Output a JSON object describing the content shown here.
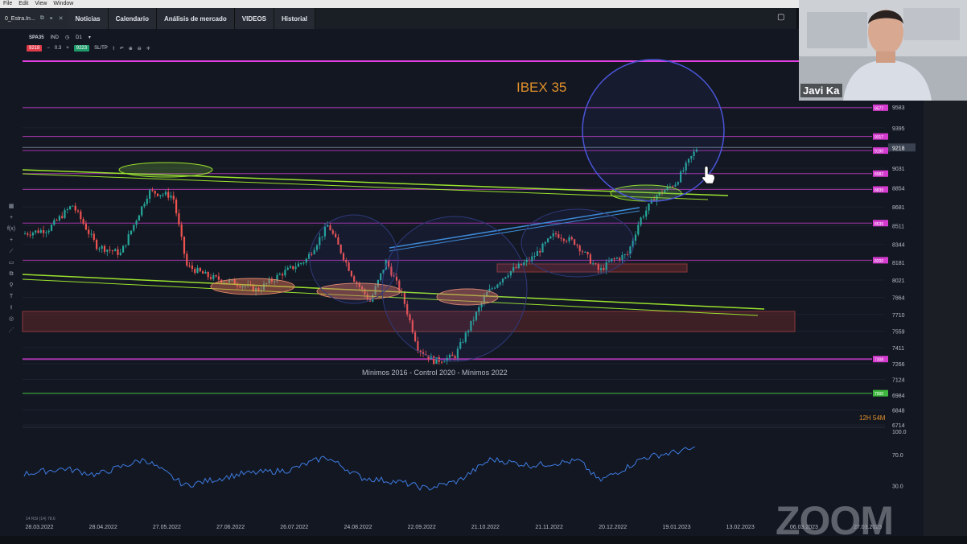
{
  "menubar": {
    "items": [
      "File",
      "Edit",
      "View",
      "Window"
    ]
  },
  "tabs": {
    "file_tab": "0_Estra.In...",
    "nav": [
      "Noticias",
      "Calendario",
      "Análisis de mercado",
      "VIDEOS",
      "Historial"
    ]
  },
  "instrument": {
    "symbol": "SPA35",
    "market": "IND",
    "timeframe": "D1",
    "sell_price": "9218",
    "spread": "0.3",
    "buy_price": "9223",
    "sltp": "SL/TP"
  },
  "chart": {
    "title": "IBEX 35",
    "annotation": "Mínimos 2016 - Control 2020 - Mínimos 2022",
    "timer": "12H 54M",
    "indicator_label": "14 RSI (14) 78.6",
    "price_axis": [
      "9583",
      "9395",
      "9218",
      "9031",
      "8854",
      "8681",
      "8511",
      "8344",
      "8181",
      "8021",
      "7864",
      "7710",
      "7559",
      "7411",
      "7266",
      "7124",
      "6984",
      "6848",
      "6714"
    ],
    "level_badges": [
      {
        "label": "9577",
        "color": "#d63bd0"
      },
      {
        "label": "9317",
        "color": "#d63bd0"
      },
      {
        "label": "9190",
        "color": "#d63bd0"
      },
      {
        "label": "8982",
        "color": "#d63bd0"
      },
      {
        "label": "8839",
        "color": "#d63bd0"
      },
      {
        "label": "8535",
        "color": "#d63bd0"
      },
      {
        "label": "8200",
        "color": "#d63bd0"
      },
      {
        "label": "7308",
        "color": "#d63bd0"
      },
      {
        "label": "7000",
        "color": "#3fb83f"
      }
    ],
    "current_price": "9218",
    "rsi_axis": [
      "100.0",
      "70.0",
      "30.0"
    ],
    "dates": [
      "28.03.2022",
      "28.04.2022",
      "27.05.2022",
      "27.06.2022",
      "26.07.2022",
      "24.08.2022",
      "22.09.2022",
      "21.10.2022",
      "21.11.2022",
      "20.12.2022",
      "19.01.2023",
      "13.02.2023",
      "06.03.2023",
      "27.03.2023"
    ]
  },
  "webcam": {
    "name": "Javi Ka"
  },
  "watermark": "ZOOM",
  "left_tools": [
    "▦",
    "+",
    "f(x)",
    "+",
    "⟋",
    "▭",
    "⧉",
    "⚲",
    "T",
    "⫲",
    "◎",
    "⋰"
  ],
  "colors": {
    "up": "#26a69a",
    "down": "#ef5350",
    "magenta": "#d63bd0",
    "lime": "#9be22d",
    "title": "#e0902a"
  }
}
